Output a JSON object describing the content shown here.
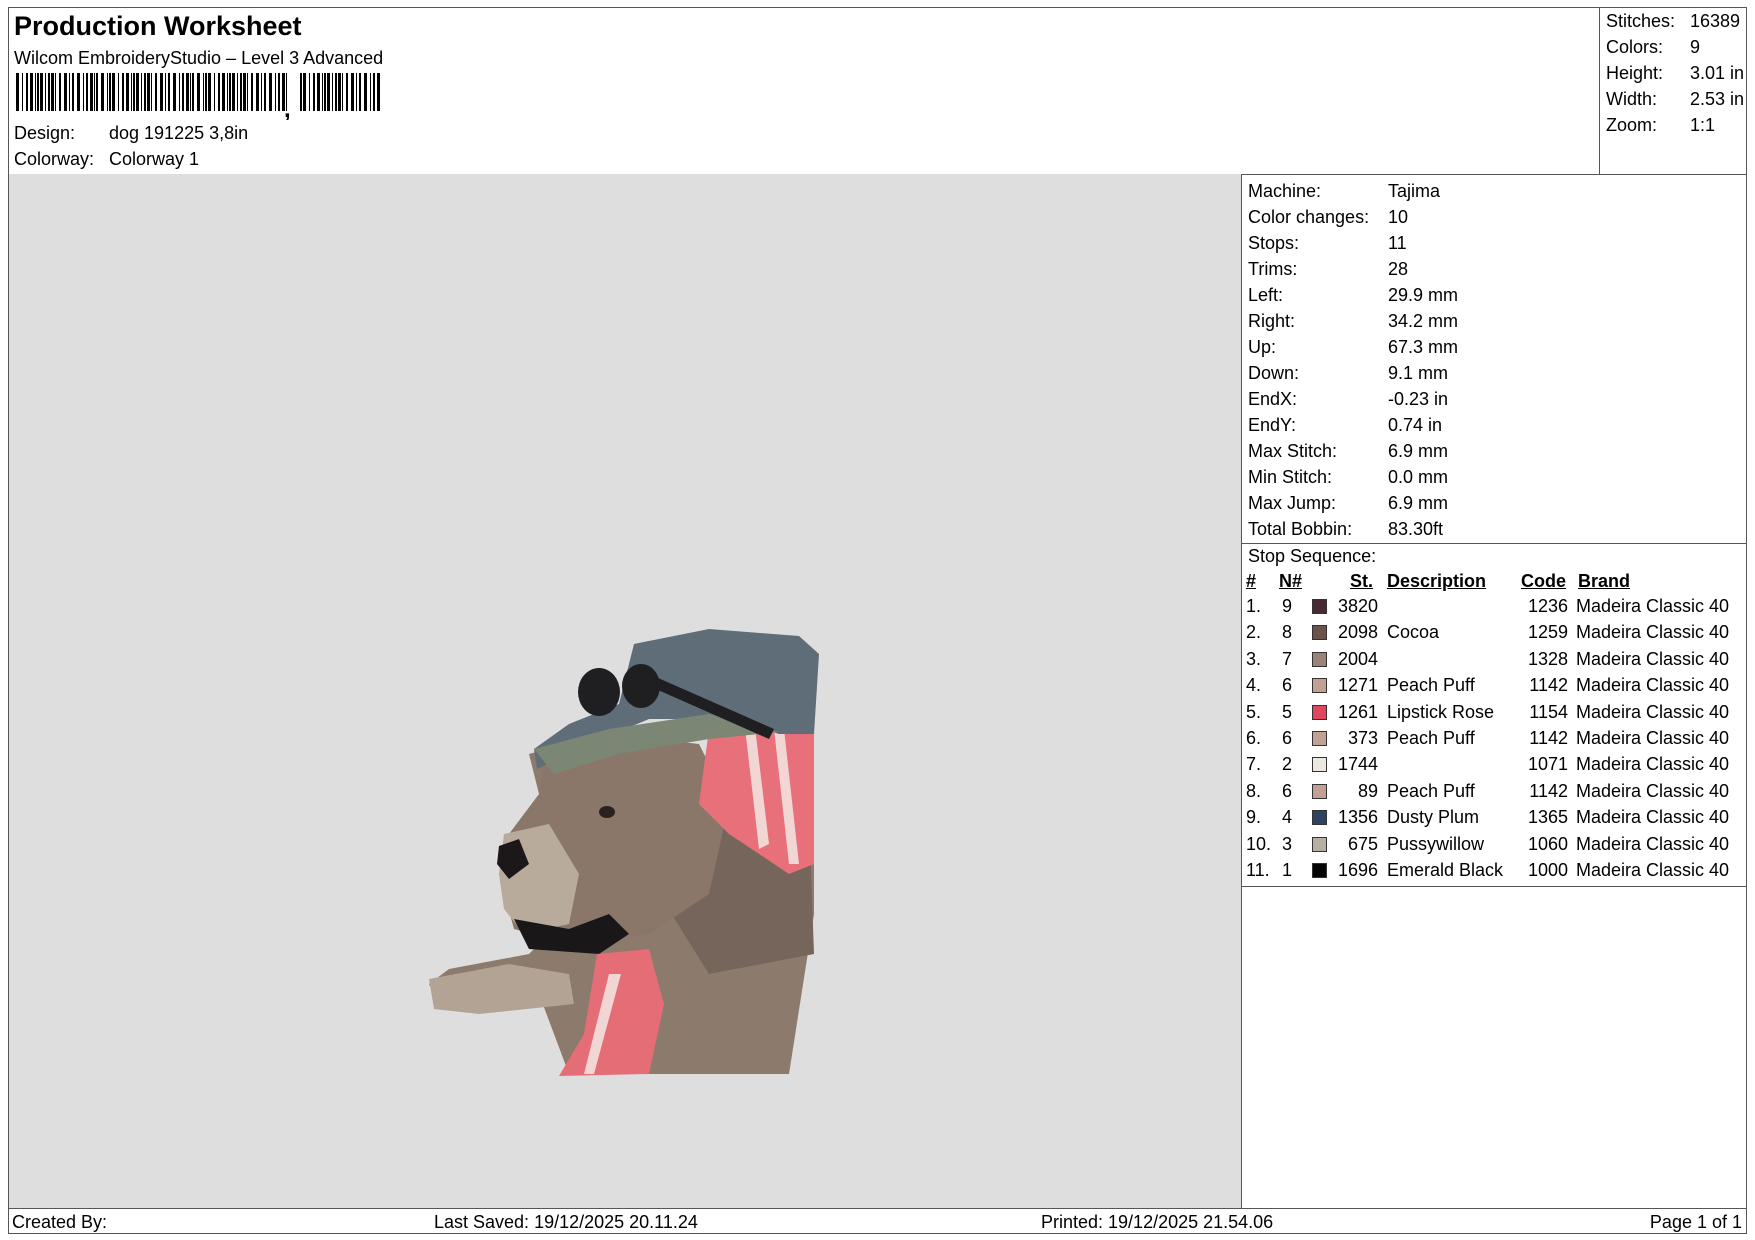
{
  "header": {
    "title": "Production Worksheet",
    "subtitle": "Wilcom EmbroideryStudio – Level 3 Advanced",
    "design_label": "Design:",
    "design_value": "dog 191225 3,8in",
    "colorway_label": "Colorway:",
    "colorway_value": "Colorway 1"
  },
  "stats": [
    {
      "label": "Stitches:",
      "value": "16389"
    },
    {
      "label": "Colors:",
      "value": "9"
    },
    {
      "label": "Height:",
      "value": "3.01 in"
    },
    {
      "label": "Width:",
      "value": "2.53 in"
    },
    {
      "label": "Zoom:",
      "value": "1:1"
    }
  ],
  "machine_info": [
    {
      "label": "Machine:",
      "value": "Tajima"
    },
    {
      "label": "Color changes:",
      "value": "10"
    },
    {
      "label": "Stops:",
      "value": "11"
    },
    {
      "label": "Trims:",
      "value": "28"
    },
    {
      "label": "Left:",
      "value": "29.9 mm"
    },
    {
      "label": "Right:",
      "value": "34.2 mm"
    },
    {
      "label": "Up:",
      "value": "67.3 mm"
    },
    {
      "label": "Down:",
      "value": "9.1 mm"
    },
    {
      "label": "EndX:",
      "value": "-0.23 in"
    },
    {
      "label": "EndY:",
      "value": "0.74 in"
    },
    {
      "label": "Max Stitch:",
      "value": "6.9 mm"
    },
    {
      "label": "Min Stitch:",
      "value": "0.0 mm"
    },
    {
      "label": "Max Jump:",
      "value": "6.9 mm"
    },
    {
      "label": "Total Bobbin:",
      "value": "83.30ft"
    }
  ],
  "stop_sequence": {
    "title": "Stop Sequence:",
    "columns": [
      "#",
      "N#",
      "St.",
      "Description",
      "Code",
      "Brand"
    ],
    "rows": [
      {
        "idx": "1.",
        "n": "9",
        "color": "#4a2a32",
        "st": "3820",
        "desc": "",
        "code": "1236",
        "brand": "Madeira Classic 40"
      },
      {
        "idx": "2.",
        "n": "8",
        "color": "#6b5349",
        "st": "2098",
        "desc": "Cocoa",
        "code": "1259",
        "brand": "Madeira Classic 40"
      },
      {
        "idx": "3.",
        "n": "7",
        "color": "#9b8378",
        "st": "2004",
        "desc": "",
        "code": "1328",
        "brand": "Madeira Classic 40"
      },
      {
        "idx": "4.",
        "n": "6",
        "color": "#c1a193",
        "st": "1271",
        "desc": "Peach Puff",
        "code": "1142",
        "brand": "Madeira Classic 40"
      },
      {
        "idx": "5.",
        "n": "5",
        "color": "#e0475f",
        "st": "1261",
        "desc": "Lipstick Rose",
        "code": "1154",
        "brand": "Madeira Classic 40"
      },
      {
        "idx": "6.",
        "n": "6",
        "color": "#c1a193",
        "st": "373",
        "desc": "Peach Puff",
        "code": "1142",
        "brand": "Madeira Classic 40"
      },
      {
        "idx": "7.",
        "n": "2",
        "color": "#ece8e1",
        "st": "1744",
        "desc": "",
        "code": "1071",
        "brand": "Madeira Classic 40"
      },
      {
        "idx": "8.",
        "n": "6",
        "color": "#c1a193",
        "st": "89",
        "desc": "Peach Puff",
        "code": "1142",
        "brand": "Madeira Classic 40"
      },
      {
        "idx": "9.",
        "n": "4",
        "color": "#2e4261",
        "st": "1356",
        "desc": "Dusty Plum",
        "code": "1365",
        "brand": "Madeira Classic 40"
      },
      {
        "idx": "10.",
        "n": "3",
        "color": "#b6b0a2",
        "st": "675",
        "desc": "Pussywillow",
        "code": "1060",
        "brand": "Madeira Classic 40"
      },
      {
        "idx": "11.",
        "n": "1",
        "color": "#050505",
        "st": "1696",
        "desc": "Emerald Black",
        "code": "1000",
        "brand": "Madeira Classic 40"
      }
    ]
  },
  "footer": {
    "created_by": "Created By:",
    "last_saved": "Last Saved: 19/12/2025 20.11.24",
    "printed": "Printed: 19/12/2025 21.54.06",
    "page": "Page 1 of 1"
  }
}
